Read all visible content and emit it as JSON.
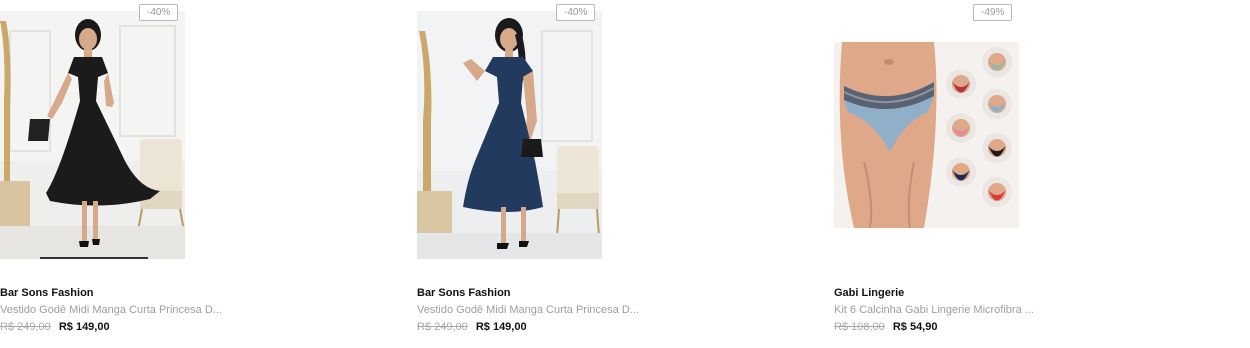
{
  "products": [
    {
      "discount": "-40%",
      "brand": "Bar Sons Fashion",
      "title": "Vestido Godê Midi Manga Curta Princesa D...",
      "old_price": "R$ 249,00",
      "price": "R$ 149,00",
      "image_desc": "woman-black-dress-photo"
    },
    {
      "discount": "-40%",
      "brand": "Bar Sons Fashion",
      "title": "Vestido Godê Midi Manga Curta Princesa D...",
      "old_price": "R$ 249,00",
      "price": "R$ 149,00",
      "image_desc": "woman-navy-dress-photo"
    },
    {
      "discount": "-49%",
      "brand": "Gabi Lingerie",
      "title": "Kit 6 Calcinha Gabi Lingerie Microfibra ...",
      "old_price": "R$ 108,00",
      "price": "R$ 54,90",
      "image_desc": "lingerie-kit-photo"
    }
  ],
  "colors": {
    "dress_black": "#1b1b1b",
    "dress_navy": "#223a5e",
    "panty_blue": "#8fb0c8"
  }
}
